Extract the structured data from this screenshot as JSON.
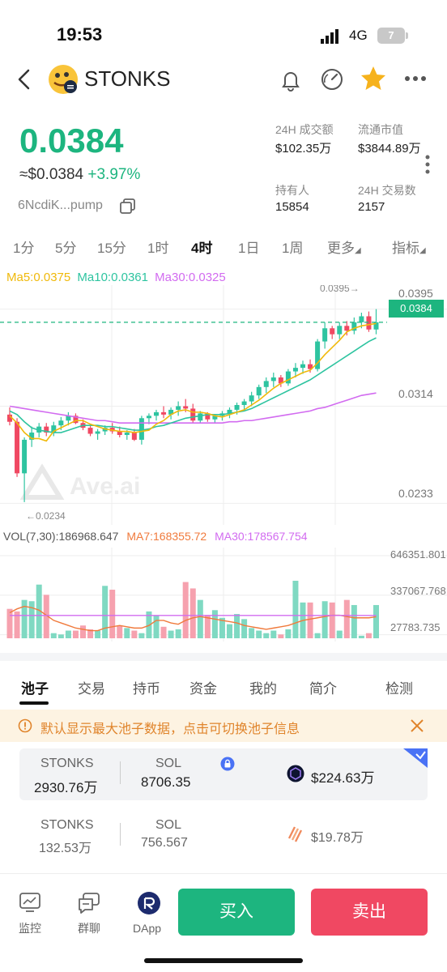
{
  "status_bar": {
    "time": "19:53",
    "network": "4G",
    "battery": "7"
  },
  "header": {
    "title": "STONKS"
  },
  "price": {
    "main": "0.0384",
    "usd": "≈$0.0384",
    "change": "+3.97%",
    "address": "6NcdiK...pump"
  },
  "stats": {
    "vol24_label": "24H 成交额",
    "vol24_value": "$102.35万",
    "mcap_label": "流通市值",
    "mcap_value": "$3844.89万",
    "holders_label": "持有人",
    "holders_value": "15854",
    "tx24_label": "24H 交易数",
    "tx24_value": "2157"
  },
  "timeframes": [
    "1分",
    "5分",
    "15分",
    "1时",
    "4时",
    "1日",
    "1周",
    "更多",
    "指标"
  ],
  "active_timeframe": "4时",
  "ma": {
    "ma5": "Ma5:0.0375",
    "ma10": "Ma10:0.0361",
    "ma30": "Ma30:0.0325"
  },
  "ma_colors": {
    "ma5": "#f0b90b",
    "ma10": "#2ec4a0",
    "ma30": "#d26bf0"
  },
  "chart_axis": {
    "y_ticks": [
      "0.0395",
      "0.0314",
      "0.0233"
    ],
    "current_price": "0.0384",
    "high_marker": "0.0395→",
    "low_marker": "←0.0234"
  },
  "watermark": "Ave.ai",
  "volume": {
    "label": "VOL(7,30):186968.647",
    "ma7": "MA7:168355.72",
    "ma30": "MA30:178567.754",
    "y_ticks": [
      "646351.801",
      "337067.768",
      "27783.735"
    ]
  },
  "chart_data": {
    "type": "candlestick",
    "interval": "4时",
    "ylim": [
      0.0215,
      0.0415
    ],
    "candles": [
      [
        0.0307,
        0.0313,
        0.0298,
        0.0301
      ],
      [
        0.0301,
        0.0304,
        0.0255,
        0.0258
      ],
      [
        0.0258,
        0.0288,
        0.0234,
        0.0286
      ],
      [
        0.0286,
        0.0297,
        0.028,
        0.0292
      ],
      [
        0.0292,
        0.03,
        0.0288,
        0.0297
      ],
      [
        0.0297,
        0.03,
        0.0289,
        0.0292
      ],
      [
        0.0292,
        0.0301,
        0.0289,
        0.0298
      ],
      [
        0.0298,
        0.0305,
        0.0294,
        0.0302
      ],
      [
        0.0302,
        0.0309,
        0.0298,
        0.0306
      ],
      [
        0.0306,
        0.0308,
        0.0299,
        0.03
      ],
      [
        0.03,
        0.0303,
        0.0294,
        0.0296
      ],
      [
        0.0296,
        0.0299,
        0.0289,
        0.0291
      ],
      [
        0.0291,
        0.0295,
        0.0286,
        0.0293
      ],
      [
        0.0293,
        0.0298,
        0.029,
        0.0296
      ],
      [
        0.0296,
        0.03,
        0.0291,
        0.0293
      ],
      [
        0.0293,
        0.0297,
        0.0288,
        0.029
      ],
      [
        0.029,
        0.0294,
        0.0286,
        0.0292
      ],
      [
        0.0292,
        0.0295,
        0.0285,
        0.0286
      ],
      [
        0.0286,
        0.0306,
        0.0282,
        0.0304
      ],
      [
        0.0304,
        0.0308,
        0.0299,
        0.0306
      ],
      [
        0.0306,
        0.0311,
        0.0302,
        0.0309
      ],
      [
        0.0309,
        0.0314,
        0.0304,
        0.0307
      ],
      [
        0.0307,
        0.0313,
        0.0303,
        0.0311
      ],
      [
        0.0311,
        0.0318,
        0.0306,
        0.0314
      ],
      [
        0.0314,
        0.032,
        0.0309,
        0.0312
      ],
      [
        0.0312,
        0.0316,
        0.03,
        0.0302
      ],
      [
        0.0302,
        0.031,
        0.03,
        0.0308
      ],
      [
        0.0308,
        0.0309,
        0.0301,
        0.0303
      ],
      [
        0.0303,
        0.0307,
        0.03,
        0.0306
      ],
      [
        0.0306,
        0.031,
        0.0302,
        0.0308
      ],
      [
        0.0308,
        0.0313,
        0.0304,
        0.0311
      ],
      [
        0.0311,
        0.0317,
        0.0307,
        0.0315
      ],
      [
        0.0315,
        0.032,
        0.0311,
        0.0318
      ],
      [
        0.0318,
        0.0326,
        0.0314,
        0.0323
      ],
      [
        0.0323,
        0.0332,
        0.032,
        0.033
      ],
      [
        0.033,
        0.0338,
        0.0325,
        0.0335
      ],
      [
        0.0335,
        0.0342,
        0.033,
        0.0338
      ],
      [
        0.0338,
        0.034,
        0.033,
        0.0333
      ],
      [
        0.0333,
        0.0345,
        0.0331,
        0.0343
      ],
      [
        0.0343,
        0.035,
        0.0338,
        0.0346
      ],
      [
        0.0346,
        0.0352,
        0.0341,
        0.0349
      ],
      [
        0.0349,
        0.0353,
        0.0342,
        0.0345
      ],
      [
        0.0345,
        0.037,
        0.0343,
        0.0368
      ],
      [
        0.0368,
        0.0384,
        0.0362,
        0.0379
      ],
      [
        0.0379,
        0.0381,
        0.037,
        0.0374
      ],
      [
        0.0374,
        0.0384,
        0.037,
        0.0381
      ],
      [
        0.0381,
        0.0385,
        0.0373,
        0.0377
      ],
      [
        0.0377,
        0.0388,
        0.0374,
        0.0384
      ],
      [
        0.0384,
        0.0392,
        0.0379,
        0.0389
      ],
      [
        0.0389,
        0.0393,
        0.0376,
        0.0378
      ],
      [
        0.0378,
        0.0395,
        0.0374,
        0.0384
      ]
    ],
    "ma5": [
      0.0306,
      0.03,
      0.0292,
      0.0287,
      0.0287,
      0.0285,
      0.0293,
      0.0296,
      0.0299,
      0.0302,
      0.0302,
      0.0299,
      0.0297,
      0.0295,
      0.0294,
      0.0293,
      0.0293,
      0.0292,
      0.0293,
      0.0294,
      0.0299,
      0.0302,
      0.0307,
      0.031,
      0.0311,
      0.0309,
      0.0309,
      0.0308,
      0.0306,
      0.0305,
      0.0307,
      0.0309,
      0.0311,
      0.0315,
      0.0319,
      0.0324,
      0.0329,
      0.0333,
      0.0336,
      0.0339,
      0.0342,
      0.0344,
      0.035,
      0.0357,
      0.0363,
      0.0369,
      0.0376,
      0.0379,
      0.0381,
      0.0382,
      0.0383
    ],
    "ma10": [
      0.031,
      0.0307,
      0.0301,
      0.0296,
      0.0294,
      0.0293,
      0.0292,
      0.0292,
      0.0294,
      0.0296,
      0.0298,
      0.0298,
      0.0298,
      0.0297,
      0.0297,
      0.0296,
      0.0295,
      0.0294,
      0.0294,
      0.0295,
      0.0297,
      0.0298,
      0.03,
      0.0302,
      0.0304,
      0.0305,
      0.0306,
      0.0307,
      0.0307,
      0.0307,
      0.0308,
      0.0309,
      0.031,
      0.0312,
      0.0315,
      0.0318,
      0.0321,
      0.0324,
      0.0327,
      0.033,
      0.0333,
      0.0336,
      0.034,
      0.0344,
      0.0348,
      0.0352,
      0.0356,
      0.036,
      0.0364,
      0.0368,
      0.0371
    ],
    "ma30": [
      0.0314,
      0.0313,
      0.0312,
      0.0311,
      0.031,
      0.0309,
      0.0308,
      0.0307,
      0.0306,
      0.0305,
      0.0304,
      0.0303,
      0.0302,
      0.0302,
      0.0301,
      0.03,
      0.03,
      0.03,
      0.03,
      0.03,
      0.03,
      0.03,
      0.03,
      0.03,
      0.03,
      0.03,
      0.03,
      0.03,
      0.03,
      0.03,
      0.0301,
      0.0301,
      0.0302,
      0.0302,
      0.0303,
      0.0304,
      0.0305,
      0.0306,
      0.0307,
      0.0308,
      0.0309,
      0.031,
      0.0312,
      0.0313,
      0.0315,
      0.0317,
      0.0319,
      0.0321,
      0.0323,
      0.0324,
      0.0325
    ],
    "volumes": [
      230000,
      210000,
      300000,
      290000,
      420000,
      340000,
      40000,
      30000,
      60000,
      60000,
      100000,
      70000,
      60000,
      410000,
      380000,
      100000,
      80000,
      60000,
      40000,
      210000,
      180000,
      90000,
      60000,
      70000,
      440000,
      390000,
      300000,
      180000,
      220000,
      160000,
      110000,
      190000,
      150000,
      80000,
      60000,
      40000,
      60000,
      30000,
      70000,
      450000,
      280000,
      280000,
      40000,
      290000,
      280000,
      60000,
      300000,
      260000,
      20000,
      40000,
      260000
    ],
    "vol_ma7": [
      200000,
      230000,
      250000,
      240000,
      220000,
      180000,
      140000,
      120000,
      100000,
      80000,
      70000,
      60000,
      60000,
      80000,
      90000,
      100000,
      90000,
      80000,
      80000,
      100000,
      140000,
      140000,
      120000,
      110000,
      140000,
      160000,
      170000,
      160000,
      150000,
      140000,
      130000,
      120000,
      100000,
      90000,
      80000,
      70000,
      80000,
      90000,
      100000,
      120000,
      140000,
      150000,
      160000,
      170000,
      180000,
      180000,
      170000,
      160000,
      160000,
      160000,
      168000
    ],
    "vol_ma30": 178567
  },
  "tabs": [
    "池子",
    "交易",
    "持币",
    "资金",
    "我的",
    "简介",
    "检测"
  ],
  "notice": {
    "text": "默认显示最大池子数据，点击可切换池子信息"
  },
  "pools": [
    {
      "token_a": "STONKS",
      "amount_a": "2930.76万",
      "token_b": "SOL",
      "amount_b": "8706.35",
      "liquidity": "$224.63万"
    },
    {
      "token_a": "STONKS",
      "amount_a": "132.53万",
      "token_b": "SOL",
      "amount_b": "756.567",
      "liquidity": "$19.78万"
    }
  ],
  "bottom_nav": {
    "monitor": "监控",
    "chat": "群聊",
    "dapp": "DApp",
    "buy": "买入",
    "sell": "卖出"
  },
  "colors": {
    "up": "#2ec4a0",
    "down": "#f04862",
    "accent": "#1db57f",
    "vol_up": "#7fd9c2",
    "vol_down": "#f6a1ae"
  }
}
